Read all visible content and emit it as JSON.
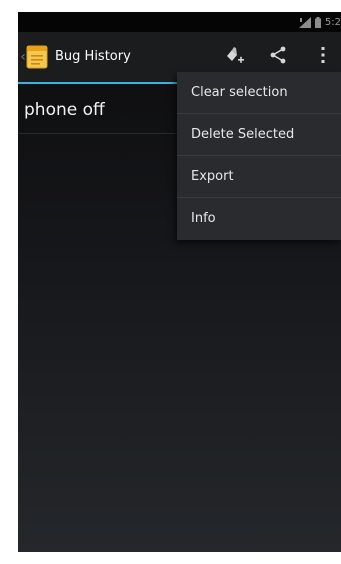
{
  "status_bar": {
    "clock": "5:2"
  },
  "action_bar": {
    "title": "Bug History",
    "up_glyph": "‹",
    "accent_color": "#33b5e5",
    "app_icon": "notepad-icon",
    "actions": [
      {
        "name": "new-bug-icon"
      },
      {
        "name": "share-icon"
      },
      {
        "name": "overflow-menu-icon"
      }
    ]
  },
  "list": {
    "items": [
      {
        "label": "phone off"
      }
    ]
  },
  "overflow_menu": {
    "items": [
      {
        "label": "Clear selection"
      },
      {
        "label": "Delete Selected"
      },
      {
        "label": "Export"
      },
      {
        "label": "Info"
      }
    ]
  }
}
